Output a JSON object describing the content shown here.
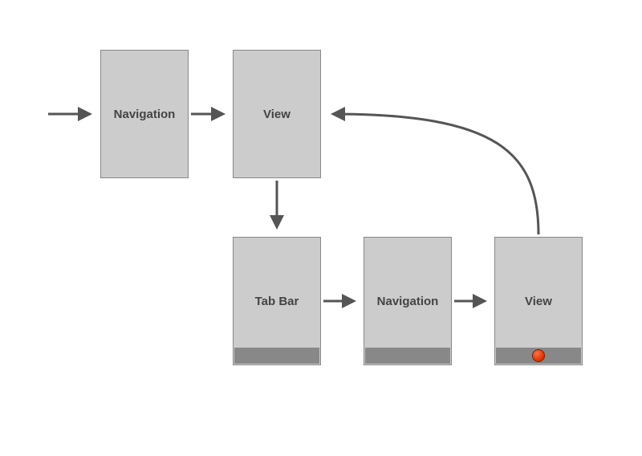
{
  "diagram": {
    "nodes": {
      "nav_top": {
        "label": "Navigation"
      },
      "view_top": {
        "label": "View"
      },
      "tabbar": {
        "label": "Tab Bar"
      },
      "nav_bottom": {
        "label": "Navigation"
      },
      "view_bottom": {
        "label": "View"
      }
    },
    "edges": [
      {
        "from": "entry",
        "to": "nav_top"
      },
      {
        "from": "nav_top",
        "to": "view_top"
      },
      {
        "from": "view_top",
        "to": "tabbar"
      },
      {
        "from": "tabbar",
        "to": "nav_bottom"
      },
      {
        "from": "nav_bottom",
        "to": "view_bottom"
      },
      {
        "from": "view_bottom",
        "to": "view_top",
        "curved": true
      }
    ]
  }
}
